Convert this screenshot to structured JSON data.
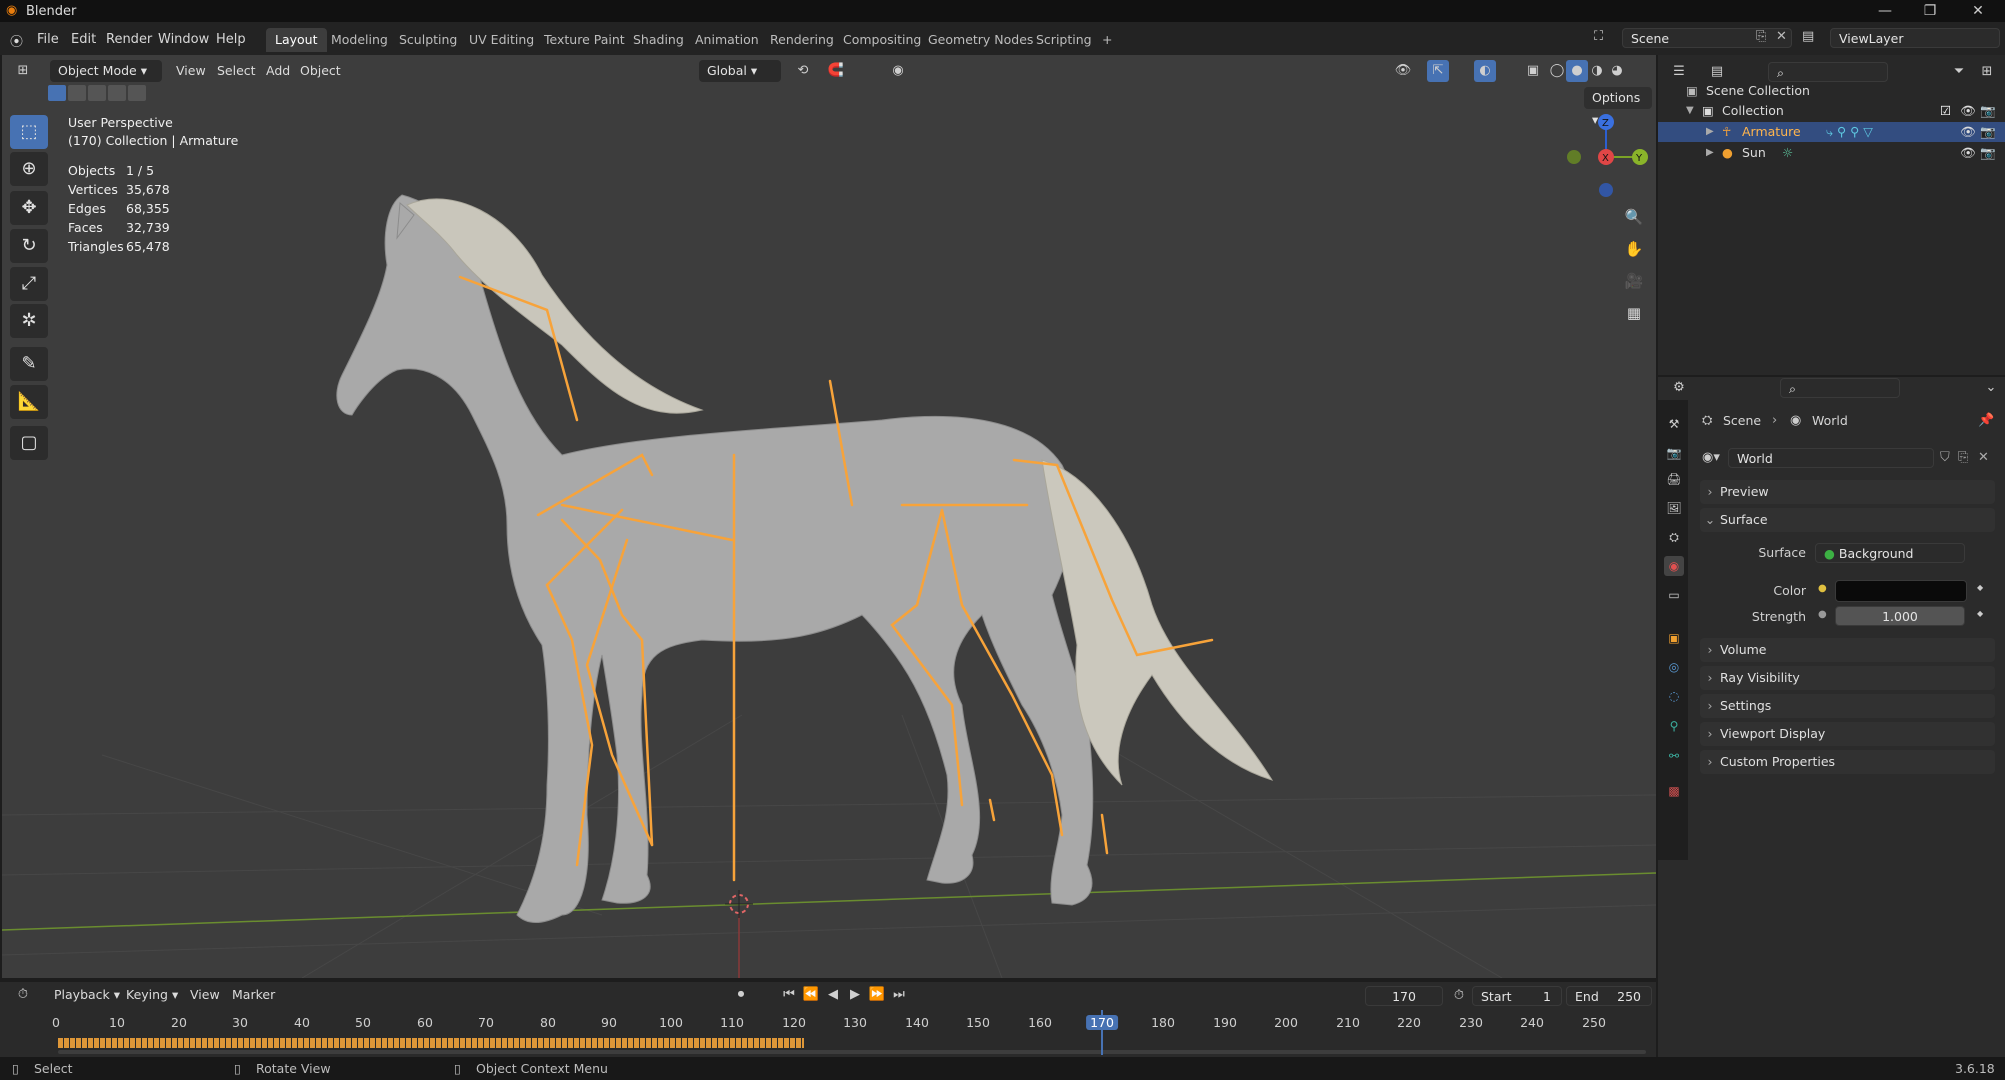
{
  "window": {
    "title": "Blender",
    "controls": [
      "—",
      "❐",
      "✕"
    ]
  },
  "menubar": {
    "items": [
      "File",
      "Edit",
      "Render",
      "Window",
      "Help"
    ],
    "workspaces": [
      "Layout",
      "Modeling",
      "Sculpting",
      "UV Editing",
      "Texture Paint",
      "Shading",
      "Animation",
      "Rendering",
      "Compositing",
      "Geometry Nodes",
      "Scripting"
    ],
    "add_tab": "+",
    "scene": "Scene",
    "view_layer": "ViewLayer"
  },
  "viewport_header": {
    "mode": "Object Mode",
    "menus": [
      "View",
      "Select",
      "Add",
      "Object"
    ],
    "transform_orientation": "Global",
    "options": "Options"
  },
  "viewport_overlay": {
    "perspective": "User Perspective",
    "collection_info": "(170) Collection | Armature",
    "stats": [
      {
        "label": "Objects",
        "value": "1 / 5"
      },
      {
        "label": "Vertices",
        "value": "35,678"
      },
      {
        "label": "Edges",
        "value": "68,355"
      },
      {
        "label": "Faces",
        "value": "32,739"
      },
      {
        "label": "Triangles",
        "value": "65,478"
      }
    ]
  },
  "gizmo": {
    "z": "Z",
    "x": "X",
    "y": "Y"
  },
  "outliner": {
    "root": "Scene Collection",
    "collection": "Collection",
    "items": [
      {
        "name": "Armature",
        "selected": true
      },
      {
        "name": "Sun",
        "selected": false
      }
    ]
  },
  "properties": {
    "breadcrumb": [
      "Scene",
      "World"
    ],
    "datablock": "World",
    "panels": {
      "preview": "Preview",
      "surface": "Surface",
      "volume": "Volume",
      "ray_visibility": "Ray Visibility",
      "settings": "Settings",
      "viewport_display": "Viewport Display",
      "custom_properties": "Custom Properties"
    },
    "surface_label": "Surface",
    "surface_value": "Background",
    "color_label": "Color",
    "color_value": "#0a0a0a",
    "strength_label": "Strength",
    "strength_value": "1.000"
  },
  "timeline": {
    "menus": [
      "Playback",
      "Keying",
      "View",
      "Marker"
    ],
    "current_frame": "170",
    "start_label": "Start",
    "start_value": "1",
    "end_label": "End",
    "end_value": "250",
    "ruler": [
      "0",
      "10",
      "20",
      "30",
      "40",
      "50",
      "60",
      "70",
      "80",
      "90",
      "100",
      "110",
      "120",
      "130",
      "140",
      "150",
      "160",
      "170",
      "180",
      "190",
      "200",
      "210",
      "220",
      "230",
      "240",
      "250"
    ]
  },
  "statusbar": {
    "hints": [
      "Select",
      "Rotate View",
      "Object Context Menu"
    ],
    "version": "3.6.18"
  },
  "colors": {
    "accent": "#4772b3",
    "bone": "#f7a33a",
    "selected_row": "#334d80"
  }
}
